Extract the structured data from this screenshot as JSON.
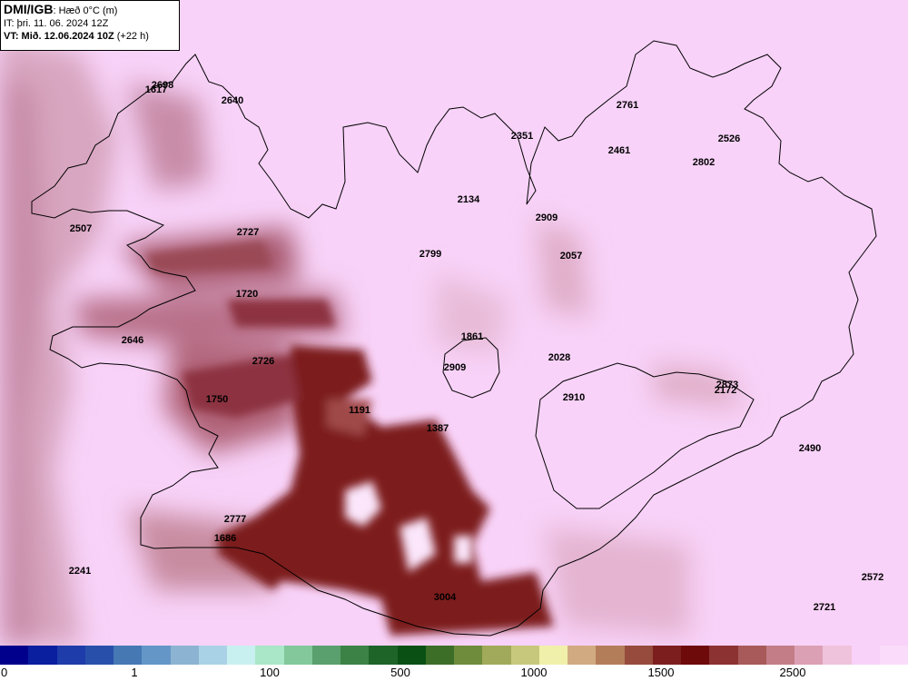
{
  "header": {
    "brand": "DMI/IGB",
    "parameter": ": Hæð 0°C (m)",
    "issue_time": "IT: þri. 11. 06. 2024 12Z",
    "valid_time_prefix": "VT: Mið. 12.06.2024 10Z",
    "lead_time": " (+22 h)"
  },
  "labels": [
    "2698",
    "1617",
    "2640",
    "2761",
    "2351",
    "2461",
    "2526",
    "2802",
    "2134",
    "2909",
    "2507",
    "2727",
    "2799",
    "2057",
    "1720",
    "1861",
    "2646",
    "2726",
    "2909",
    "2028",
    "2873",
    "2172",
    "1750",
    "2910",
    "1191",
    "1387",
    "2490",
    "2777",
    "1686",
    "2241",
    "3004",
    "2572",
    "2721"
  ],
  "colorbar": {
    "ticks": [
      "0",
      "1",
      "100",
      "500",
      "1000",
      "1500",
      "2500"
    ],
    "colors": [
      "#00008c",
      "#0a1ea0",
      "#1e3caa",
      "#2850aa",
      "#4678b4",
      "#6496c8",
      "#8cb4d2",
      "#aad2e6",
      "#c8f0f0",
      "#aae6c8",
      "#82c89a",
      "#5aa06e",
      "#3c8246",
      "#1e6428",
      "#0a5014",
      "#3c6e28",
      "#6e8c3c",
      "#a0aa5a",
      "#c8c87d",
      "#f0f0aa",
      "#d2aa82",
      "#b47d5a",
      "#964b3c",
      "#7d1e1e",
      "#6e0a0a",
      "#8c3232",
      "#a85a5a",
      "#c37d87",
      "#dca0b4",
      "#f0c3dc",
      "#f8d2f8",
      "#fadcfa"
    ],
    "colors_meaning": "fill colors from 0 m (blue) to above 2500 m (pink)"
  },
  "map_colors": {
    "background": "#f8d2f8",
    "dark_red": "#7d1e1e",
    "mid_red": "#9a4a55",
    "light_mauve": "#c88ca0",
    "pale_mauve": "#e0aec8",
    "whiteish": "#fbe6fb"
  }
}
